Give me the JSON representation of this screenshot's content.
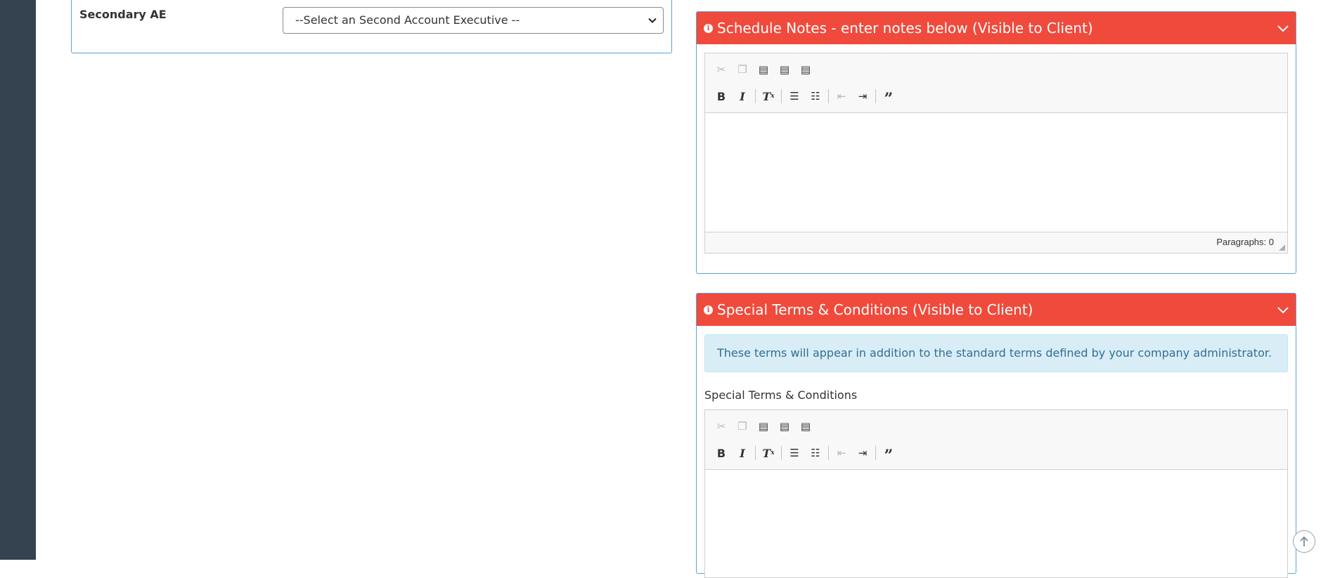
{
  "secondary_ae": {
    "label": "Secondary AE",
    "select_value": "--Select an Second Account Executive --"
  },
  "schedule_notes": {
    "header_title": "Schedule Notes - enter notes below (Visible to Client)",
    "status_text": "Paragraphs: 0"
  },
  "special_terms": {
    "header_title": "Special Terms & Conditions (Visible to Client)",
    "alert_text": "These terms will appear in addition to the standard terms defined by your company administrator.",
    "field_label": "Special Terms & Conditions"
  },
  "toolbar_icons": {
    "row1": [
      "cut-icon",
      "copy-icon",
      "paste-icon",
      "paste-text-icon",
      "paste-word-icon"
    ],
    "row2": [
      "bold-icon",
      "italic-icon",
      "remove-format-icon",
      "numbered-list-icon",
      "bulleted-list-icon",
      "outdent-icon",
      "indent-icon",
      "blockquote-icon"
    ]
  },
  "colors": {
    "header_red": "#f04a3c",
    "sidebar": "#35424f",
    "panel_border": "#5aa3d6",
    "alert_bg": "#d9edf7",
    "alert_text": "#31708f"
  }
}
